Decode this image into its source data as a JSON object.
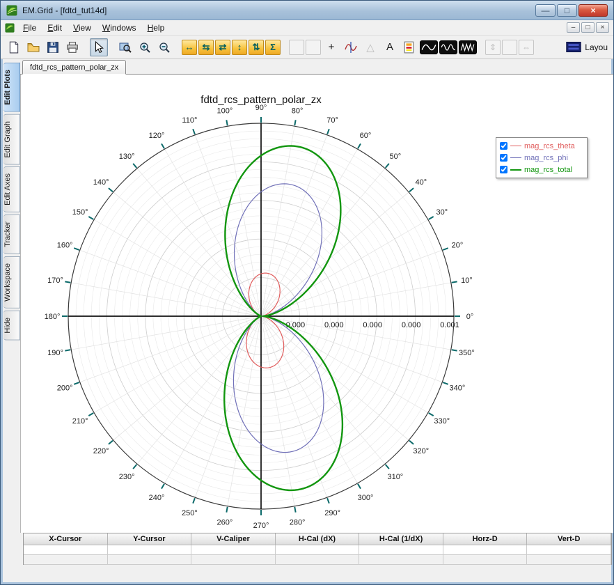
{
  "window": {
    "title": "EM.Grid - [fdtd_tut14d]",
    "titlebar_buttons": [
      {
        "name": "minimize-button",
        "glyph": "—"
      },
      {
        "name": "restore-button",
        "glyph": "□"
      },
      {
        "name": "close-button",
        "glyph": "×"
      }
    ]
  },
  "menu": {
    "items": [
      "File",
      "Edit",
      "View",
      "Windows",
      "Help"
    ]
  },
  "mdi_buttons": [
    {
      "name": "child-minimize-button",
      "glyph": "–"
    },
    {
      "name": "child-restore-button",
      "glyph": "□"
    },
    {
      "name": "child-close-button",
      "glyph": "×"
    }
  ],
  "toolbar": {
    "layout_label": "Layou",
    "items": [
      {
        "name": "new-file-icon",
        "style": "page"
      },
      {
        "name": "open-file-icon",
        "style": "folder"
      },
      {
        "name": "save-icon",
        "style": "floppy"
      },
      {
        "name": "print-icon",
        "style": "printer"
      },
      {
        "name": "separator"
      },
      {
        "name": "pointer-tool-icon",
        "style": "pointer",
        "pressed": true
      },
      {
        "name": "separator"
      },
      {
        "name": "zoom-window-icon",
        "style": "zoomwin"
      },
      {
        "name": "zoom-in-icon",
        "style": "zoomin"
      },
      {
        "name": "zoom-out-icon",
        "style": "zoomout"
      },
      {
        "name": "separator"
      },
      {
        "name": "pan-horizontal-icon",
        "style": "gold",
        "glyph": "↔"
      },
      {
        "name": "expand-horizontal-icon",
        "style": "gold",
        "glyph": "⇆"
      },
      {
        "name": "compress-horizontal-icon",
        "style": "gold",
        "glyph": "⇄"
      },
      {
        "name": "pan-vertical-icon",
        "style": "gold",
        "glyph": "↕"
      },
      {
        "name": "expand-vertical-icon",
        "style": "gold",
        "glyph": "⇅"
      },
      {
        "name": "autoscale-icon",
        "style": "gold",
        "glyph": "Σ"
      },
      {
        "name": "separator"
      },
      {
        "name": "line-select-icon",
        "style": "plain",
        "glyph": "",
        "disabled": true
      },
      {
        "name": "box-select-icon",
        "style": "plain",
        "glyph": "",
        "disabled": true
      },
      {
        "name": "crosshair-icon",
        "style": "glyph",
        "glyph": "+"
      },
      {
        "name": "tracker-icon",
        "style": "tracker"
      },
      {
        "name": "caliper-icon",
        "style": "glyph",
        "glyph": "△",
        "disabled": true
      },
      {
        "name": "text-tool-icon",
        "style": "glyph",
        "glyph": "A"
      },
      {
        "name": "notes-icon",
        "style": "palette"
      },
      {
        "name": "fft-icon",
        "style": "wave1"
      },
      {
        "name": "filter-icon",
        "style": "wave2"
      },
      {
        "name": "window-func-icon",
        "style": "wave3"
      },
      {
        "name": "separator"
      },
      {
        "name": "vert-fit-icon",
        "style": "plain",
        "glyph": "⇕",
        "disabled": true
      },
      {
        "name": "marker-icon",
        "style": "plain",
        "glyph": "",
        "disabled": true
      },
      {
        "name": "horz-fit-icon",
        "style": "plain",
        "glyph": "⇔",
        "disabled": true
      },
      {
        "name": "separator"
      },
      {
        "name": "layout-button",
        "style": "layout"
      }
    ]
  },
  "sidebar": {
    "tabs": [
      "Edit Plots",
      "Edit Graph",
      "Edit Axes",
      "Tracker",
      "Workspace",
      "Hide"
    ],
    "selected_index": 0
  },
  "doc_tabs": [
    {
      "label": "fdtd_rcs_pattern_polar_zx",
      "active": true
    }
  ],
  "chart_data": {
    "type": "polar",
    "title": "fdtd_rcs_pattern_polar_zx",
    "angle_unit": "degrees",
    "angle_tick_step_deg": 10,
    "angle_labels": [
      "0°",
      "10°",
      "20°",
      "30°",
      "40°",
      "50°",
      "60°",
      "70°",
      "80°",
      "90°",
      "100°",
      "110°",
      "120°",
      "130°",
      "140°",
      "150°",
      "160°",
      "170°",
      "180°",
      "190°",
      "200°",
      "210°",
      "220°",
      "230°",
      "240°",
      "250°",
      "260°",
      "270°",
      "280°",
      "290°",
      "300°",
      "310°",
      "320°",
      "330°",
      "340°",
      "350°"
    ],
    "radial_tick_labels": [
      "0.000",
      "0.000",
      "0.000",
      "0.000",
      "0.001"
    ],
    "radial_max_value": 0.001,
    "grid": {
      "radial_rings": 25,
      "major_every": 5,
      "spoke_step_deg": 10
    },
    "series": [
      {
        "name": "mag_rcs_theta",
        "color": "#e05c5c",
        "line_width": 1.2,
        "peak_angle_deg": 82,
        "amp_upper": 0.225,
        "amp_lower": 0.27,
        "exponent": 2.4
      },
      {
        "name": "mag_rcs_phi",
        "color": "#7070b8",
        "line_width": 1.2,
        "peak_angle_deg": 77,
        "amp_upper": 0.7,
        "amp_lower": 0.72,
        "exponent": 3.2
      },
      {
        "name": "mag_rcs_total",
        "color": "#12960f",
        "line_width": 2.4,
        "peak_angle_deg": 77,
        "amp_upper": 0.9,
        "amp_lower": 0.92,
        "exponent": 3.0
      }
    ],
    "legend": [
      {
        "label": "mag_rcs_theta",
        "color": "#e05c5c",
        "checked": true
      },
      {
        "label": "mag_rcs_phi",
        "color": "#7070b8",
        "checked": true
      },
      {
        "label": "mag_rcs_total",
        "color": "#12960f",
        "checked": true
      }
    ],
    "legend_position": "right"
  },
  "readout": {
    "headers": [
      "X-Cursor",
      "Y-Cursor",
      "V-Caliper",
      "H-Cal (dX)",
      "H-Cal (1/dX)",
      "Horz-D",
      "Vert-D"
    ],
    "rows": [
      [
        "",
        "",
        "",
        "",
        "",
        "",
        ""
      ],
      [
        "",
        "",
        "",
        "",
        "",
        "",
        ""
      ]
    ]
  }
}
